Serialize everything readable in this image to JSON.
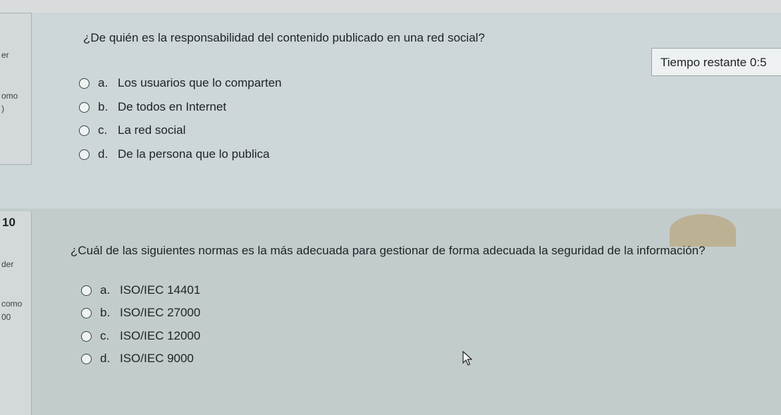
{
  "sidebar": {
    "q1_fragments": [
      "er",
      "omo",
      ")"
    ],
    "q2_number": "10",
    "q2_fragments": [
      "der",
      "como",
      "00"
    ]
  },
  "timer": {
    "label": "Tiempo restante 0:5"
  },
  "question1": {
    "text": "¿De quién es la responsabilidad del contenido publicado en una red social?",
    "options": [
      {
        "letter": "a.",
        "text": "Los usuarios que lo comparten"
      },
      {
        "letter": "b.",
        "text": "De todos en Internet"
      },
      {
        "letter": "c.",
        "text": "La red social"
      },
      {
        "letter": "d.",
        "text": "De la persona que lo publica"
      }
    ]
  },
  "question2": {
    "text": "¿Cuál de las siguientes normas es la más adecuada para gestionar de forma adecuada la seguridad de la información?",
    "options": [
      {
        "letter": "a.",
        "text": "ISO/IEC 14401"
      },
      {
        "letter": "b.",
        "text": "ISO/IEC 27000"
      },
      {
        "letter": "c.",
        "text": "ISO/IEC 12000"
      },
      {
        "letter": "d.",
        "text": "ISO/IEC 9000"
      }
    ]
  }
}
